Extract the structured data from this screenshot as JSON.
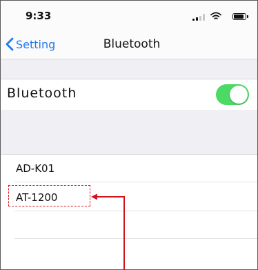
{
  "status_bar": {
    "time": "9:33",
    "icons": [
      "signal-icon",
      "wifi-icon",
      "battery-icon"
    ]
  },
  "nav": {
    "back_label": "Setting",
    "back_icon": "chevron-left-icon",
    "title": "Bluetooth"
  },
  "bluetooth_toggle": {
    "label": "Bluetooth",
    "on": true
  },
  "devices": [
    {
      "label": "AD-K01"
    },
    {
      "label": "AT-1200"
    },
    {
      "label": ""
    },
    {
      "label": ""
    }
  ],
  "annotation": {
    "highlighted_device": "AT-1200"
  },
  "colors": {
    "accent": "#1f7aec",
    "toggle_on": "#4cd964",
    "annotation": "#d0141a",
    "grouped_background": "#efeff4"
  }
}
